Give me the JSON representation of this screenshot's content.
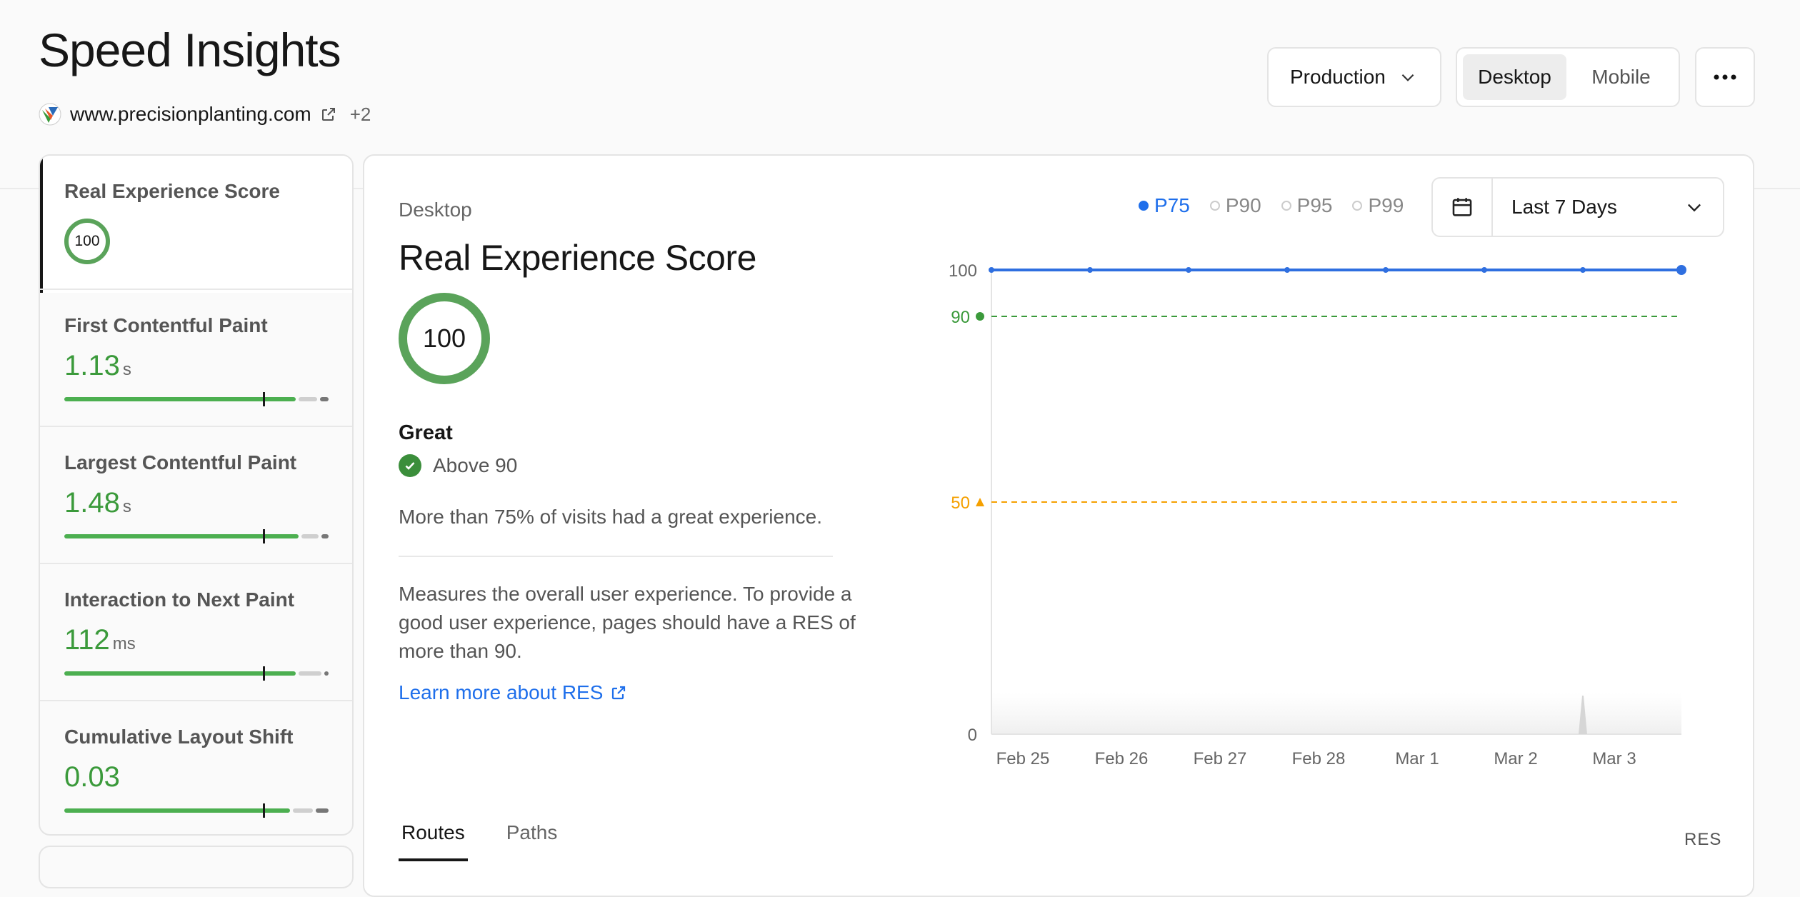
{
  "page": {
    "title": "Speed Insights",
    "site": "www.precisionplanting.com",
    "site_extra": "+2"
  },
  "toolbar": {
    "environment": "Production",
    "device_options": [
      "Desktop",
      "Mobile"
    ],
    "device_selected": "Desktop",
    "more_icon": "ellipsis-icon"
  },
  "sidebar": {
    "items": [
      {
        "label": "Real Experience Score",
        "value": "100",
        "unit": "",
        "active": true
      },
      {
        "label": "First Contentful Paint",
        "value": "1.13",
        "unit": "s"
      },
      {
        "label": "Largest Contentful Paint",
        "value": "1.48",
        "unit": "s"
      },
      {
        "label": "Interaction to Next Paint",
        "value": "112",
        "unit": "ms"
      },
      {
        "label": "Cumulative Layout Shift",
        "value": "0.03",
        "unit": ""
      }
    ]
  },
  "detail": {
    "device": "Desktop",
    "title": "Real Experience Score",
    "score": "100",
    "rating": "Great",
    "threshold_text": "Above 90",
    "summary": "More than 75% of visits had a great experience.",
    "description": "Measures the overall user experience. To provide a good user experience, pages should have a RES of more than 90.",
    "learn_more": "Learn more about RES"
  },
  "percentiles": {
    "options": [
      "P75",
      "P90",
      "P95",
      "P99"
    ],
    "selected": "P75"
  },
  "date_range": {
    "label": "Last 7 Days"
  },
  "chart_data": {
    "type": "line",
    "x": [
      "Feb 25",
      "Feb 26",
      "Feb 27",
      "Feb 28",
      "Mar 1",
      "Mar 2",
      "Mar 3",
      ""
    ],
    "series": [
      {
        "name": "P75",
        "values": [
          100,
          100,
          100,
          100,
          100,
          100,
          100,
          100
        ],
        "color": "#2f6fe0"
      }
    ],
    "ylim": [
      0,
      100
    ],
    "yticks": [
      "100",
      "0"
    ],
    "thresholds": [
      {
        "value": 90,
        "label": "90",
        "color": "#3b9a3b",
        "marker": "circle"
      },
      {
        "value": 50,
        "label": "50",
        "color": "#f5a000",
        "marker": "triangle"
      }
    ]
  },
  "tabs": {
    "items": [
      "Routes",
      "Paths"
    ],
    "active": "Routes",
    "column_label": "RES"
  }
}
